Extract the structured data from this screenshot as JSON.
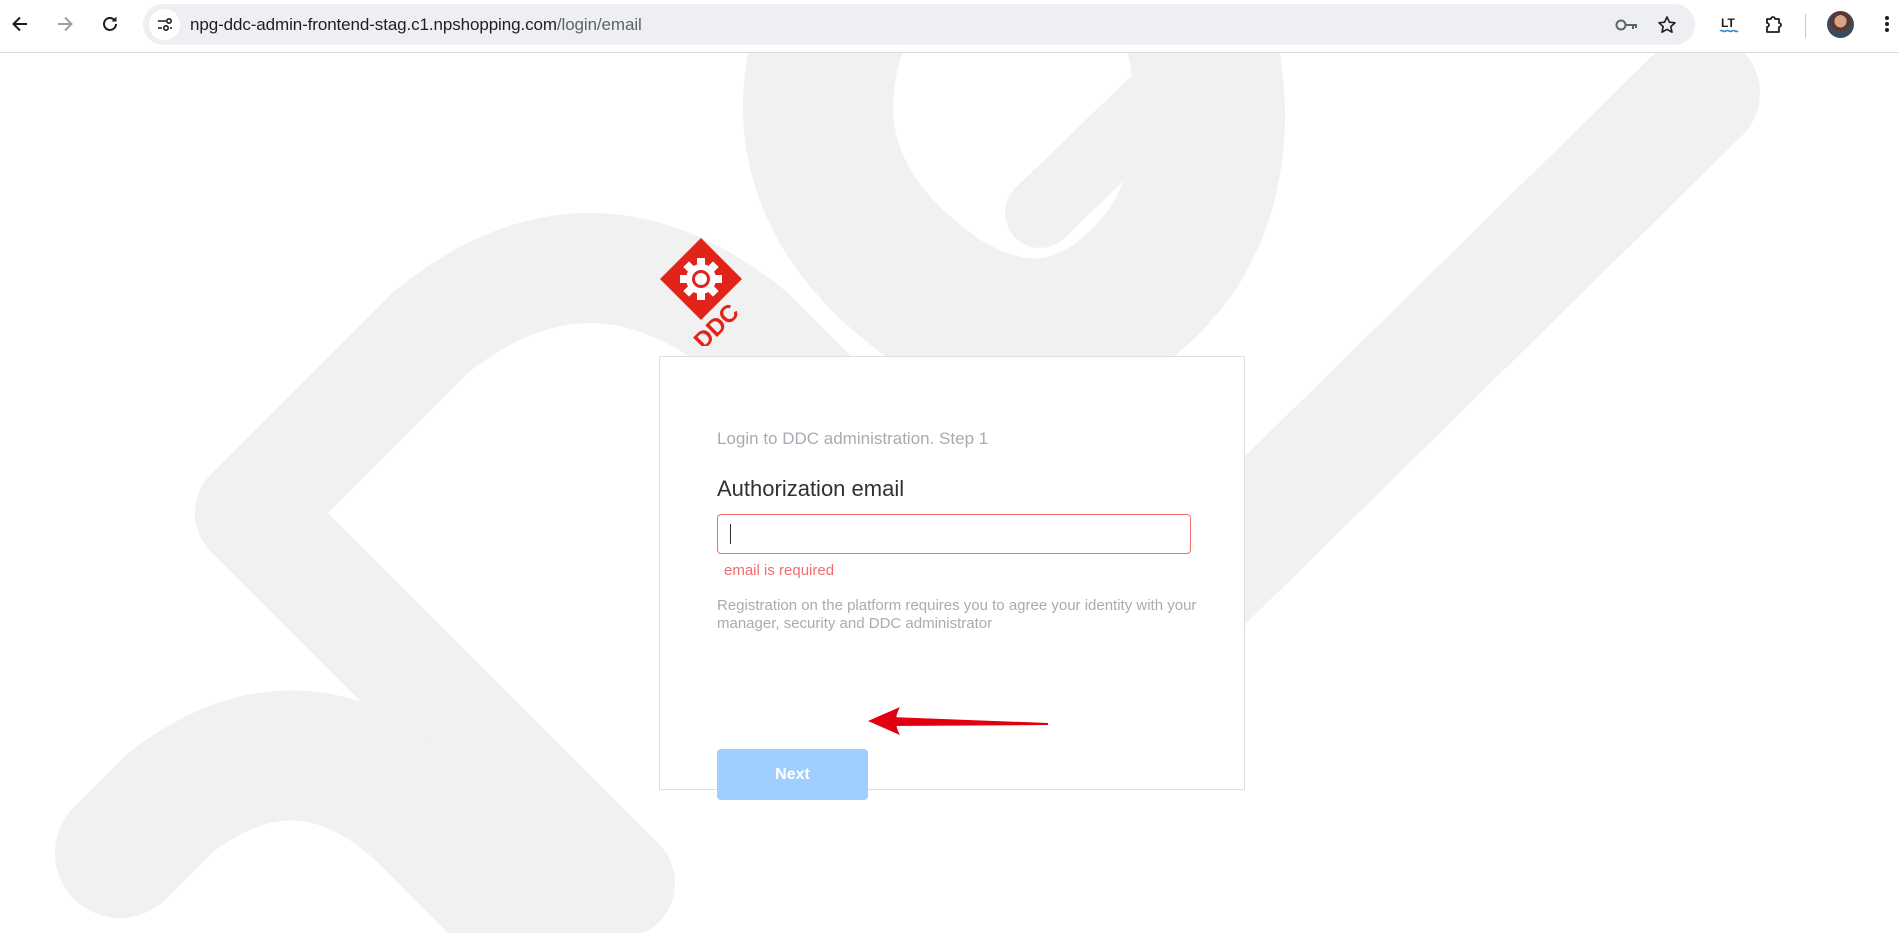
{
  "browser": {
    "url_host": "npg-ddc-admin-frontend-stag.c1.npshopping.com",
    "url_path": "/login/email",
    "icons": {
      "back": "back-arrow-icon",
      "forward": "forward-arrow-icon",
      "reload": "reload-icon",
      "site_info": "tune-icon",
      "password": "key-icon",
      "bookmark": "star-icon",
      "extension_lt": "lt-extension-icon",
      "extensions": "puzzle-icon",
      "profile": "avatar",
      "menu": "kebab-menu-icon"
    },
    "extension_lt_text": "LT"
  },
  "logo": {
    "text": "DDC",
    "color": "#e2231a"
  },
  "login": {
    "step_text": "Login to DDC administration. Step 1",
    "field_label": "Authorization email",
    "email_value": "",
    "error_text": "email is required",
    "hint_text": "Registration on the platform requires you to agree your identity with your manager, security and DDC administrator",
    "next_label": "Next"
  },
  "colors": {
    "error": "#f56c6c",
    "button_disabled": "#a0cfff",
    "annotation_arrow": "#e0000f"
  }
}
